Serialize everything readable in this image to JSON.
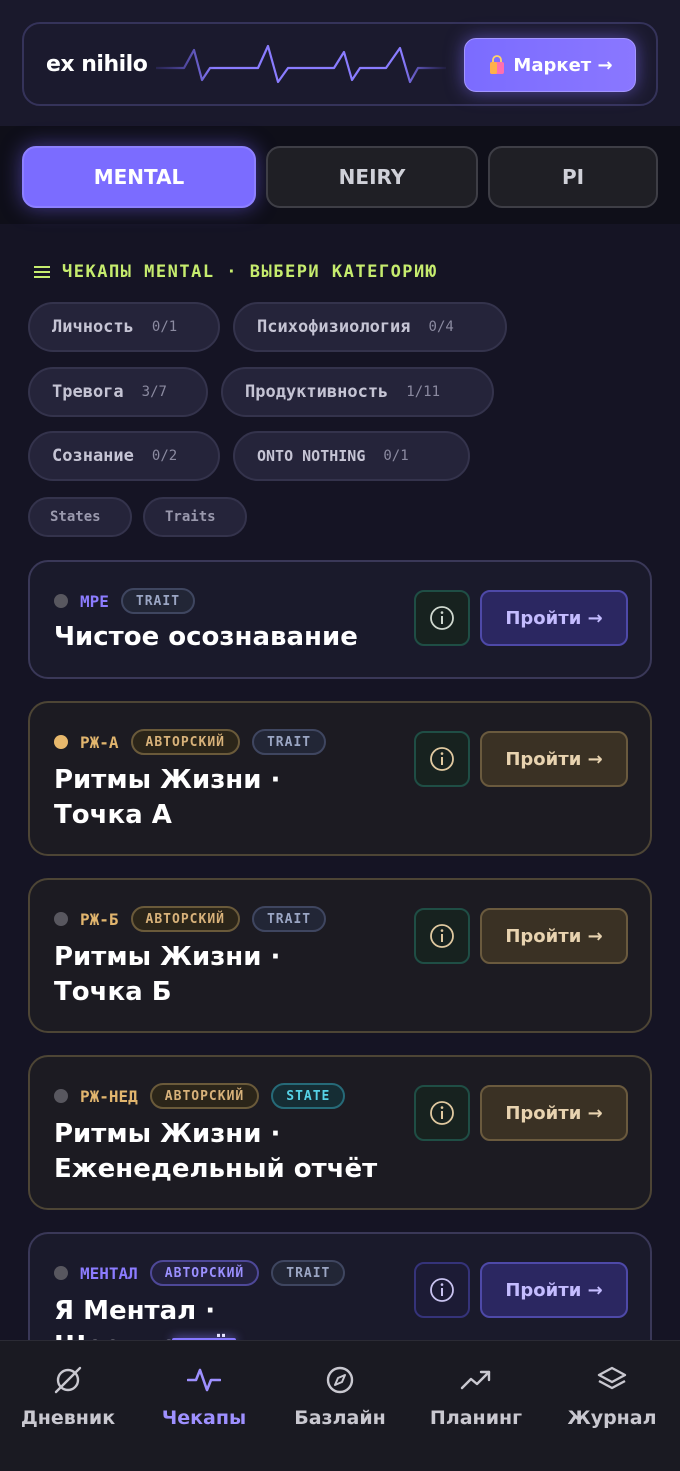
{
  "header": {
    "brand": "ex nihilo",
    "market_button": "Маркет →",
    "market_icon": "shopping-bag-icon"
  },
  "tabs": [
    {
      "label": "MENTAL",
      "active": true
    },
    {
      "label": "NEIRY",
      "active": false
    },
    {
      "label": "PI",
      "active": false
    }
  ],
  "section": {
    "title": "ЧЕКАПЫ MENTAL · ВЫБЕРИ КАТЕГОРИЮ"
  },
  "categories": [
    {
      "label": "Личность",
      "count": "0/1"
    },
    {
      "label": "Психофизиология",
      "count": "0/4"
    },
    {
      "label": "Тревога",
      "count": "3/7"
    },
    {
      "label": "Продуктивность",
      "count": "1/11"
    },
    {
      "label": "Сознание",
      "count": "0/2"
    },
    {
      "label": "ONTO NOTHING",
      "count": "0/1"
    }
  ],
  "filters": [
    "States",
    "Traits"
  ],
  "cards": [
    {
      "code": "MPE",
      "badges": [
        "TRAIT"
      ],
      "title_lines": [
        "Чистое осознавание"
      ],
      "button": "Пройти →",
      "active_dot": false
    },
    {
      "code": "РЖ-А",
      "badges": [
        "АВТОРСКИЙ",
        "TRAIT"
      ],
      "title_lines": [
        "Ритмы Жизни ·",
        "Точка А"
      ],
      "button": "Пройти →",
      "active_dot": true
    },
    {
      "code": "РЖ-Б",
      "badges": [
        "АВТОРСКИЙ",
        "TRAIT"
      ],
      "title_lines": [
        "Ритмы Жизни ·",
        "Точка Б"
      ],
      "button": "Пройти →",
      "active_dot": false
    },
    {
      "code": "РЖ-НЕД",
      "badges": [
        "АВТОРСКИЙ",
        "STATE"
      ],
      "title_lines": [
        "Ритмы Жизни ·",
        "Еженедельный отчёт"
      ],
      "button": "Пройти →",
      "active_dot": false
    },
    {
      "code": "МЕНТАЛ",
      "badges": [
        "АВТОРСКИЙ",
        "TRAIT"
      ],
      "title_lines": [
        "Я Ментал ·",
        "Шесть слоёв"
      ],
      "button": "Пройти →",
      "active_dot": false
    }
  ],
  "nav": [
    {
      "label": "Дневник",
      "icon": "empty-set-icon",
      "active": false
    },
    {
      "label": "Чекапы",
      "icon": "pulse-icon",
      "active": true
    },
    {
      "label": "Базлайн",
      "icon": "compass-icon",
      "active": false
    },
    {
      "label": "Планинг",
      "icon": "trending-up-icon",
      "active": false
    },
    {
      "label": "Журнал",
      "icon": "layers-icon",
      "active": false
    }
  ]
}
